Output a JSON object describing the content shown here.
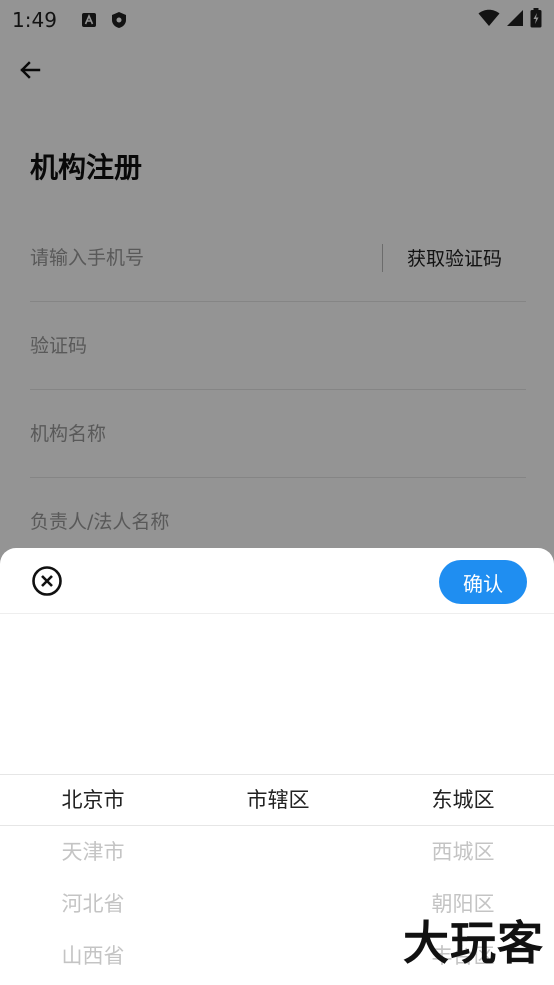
{
  "status_bar": {
    "time": "1:49"
  },
  "page": {
    "title": "机构注册"
  },
  "form": {
    "phone_placeholder": "请输入手机号",
    "get_code_label": "获取验证码",
    "code_placeholder": "验证码",
    "org_name_placeholder": "机构名称",
    "legal_name_placeholder": "负责人/法人名称"
  },
  "sheet": {
    "confirm_label": "确认"
  },
  "picker": {
    "provinces": [
      "北京市",
      "天津市",
      "河北省",
      "山西省"
    ],
    "cities": [
      "市辖区"
    ],
    "districts": [
      "东城区",
      "西城区",
      "朝阳区",
      "丰台区"
    ]
  },
  "watermark": "大玩客",
  "colors": {
    "accent": "#1f8ef1",
    "overlay": "rgba(0,0,0,0.42)"
  }
}
